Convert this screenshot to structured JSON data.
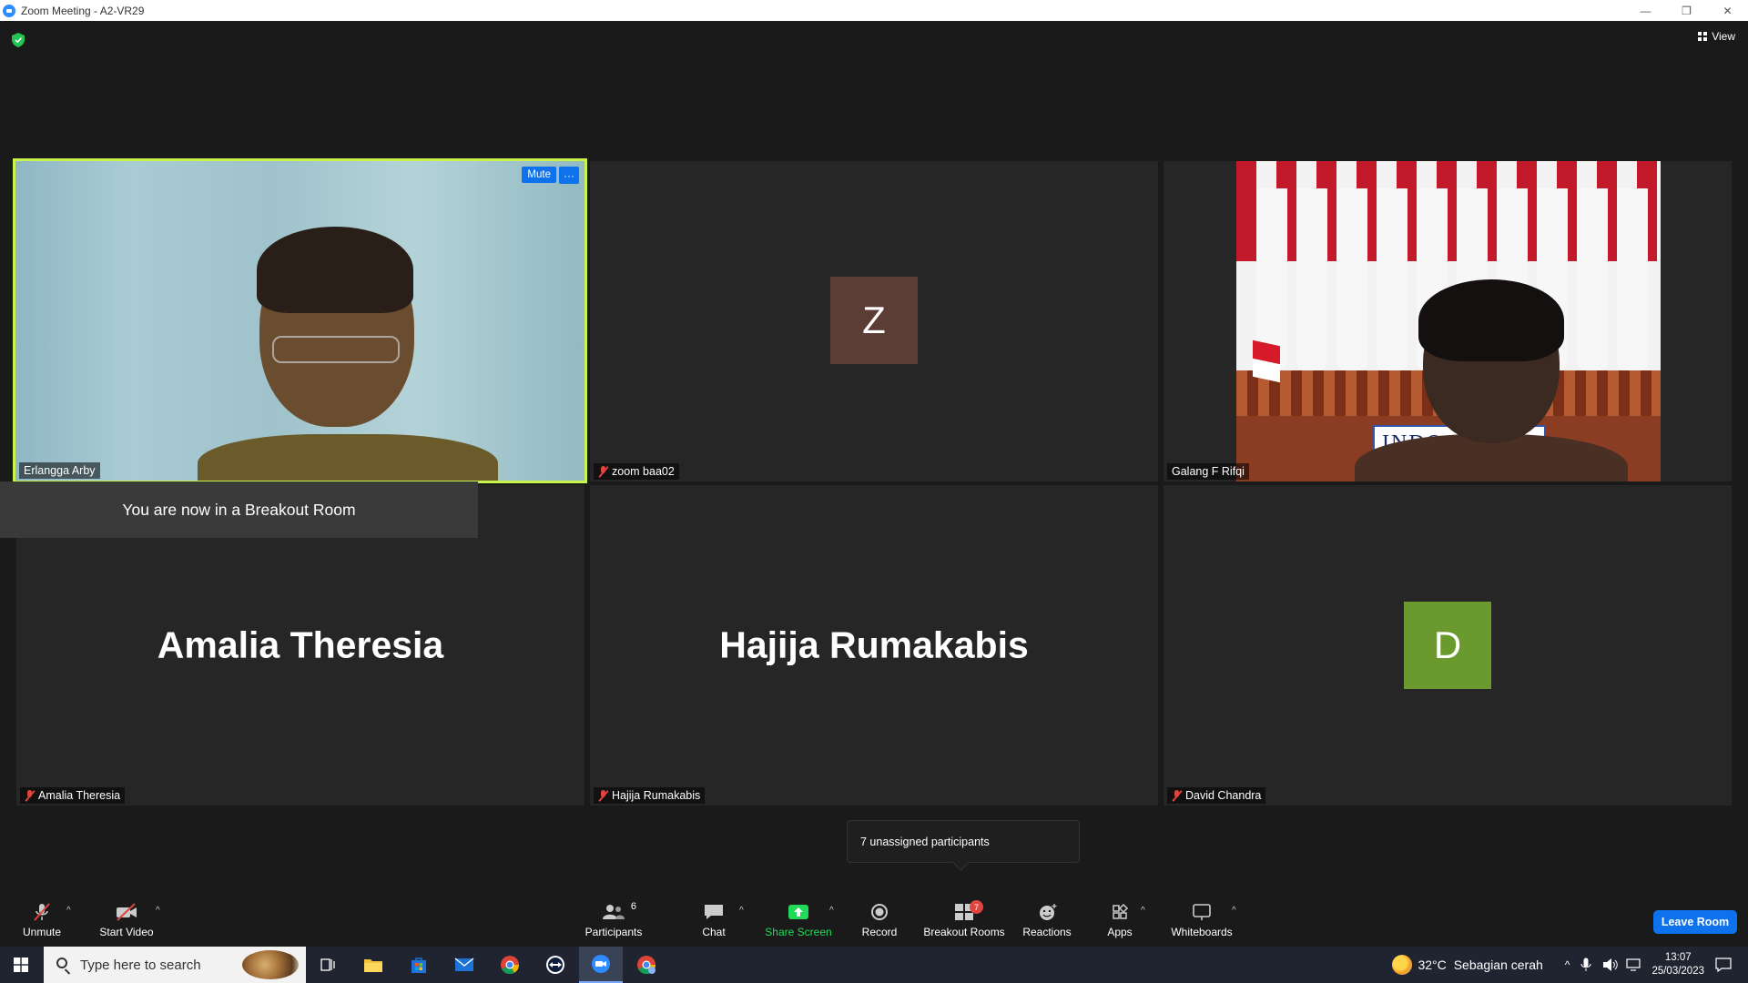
{
  "window": {
    "title": "Zoom Meeting - A2-VR29",
    "minimize": "—",
    "restore": "❐",
    "close": "✕"
  },
  "top": {
    "view_label": "View"
  },
  "tiles": [
    {
      "name": "Erlangga Arby",
      "mute_label": "Mute",
      "more_label": "···"
    },
    {
      "name": "zoom baa02",
      "avatar_letter": "Z",
      "avatar_color": "#5c3d36"
    },
    {
      "name": "Galang F Rifqi",
      "nameplate": "INDO"
    },
    {
      "name": "Amalia Theresia",
      "big_label": "Amalia Theresia"
    },
    {
      "name": "Hajija Rumakabis",
      "big_label": "Hajija Rumakabis"
    },
    {
      "name": "David Chandra",
      "avatar_letter": "D",
      "avatar_color": "#6a9a2e"
    }
  ],
  "notice": "You are now in a Breakout Room",
  "tooltip": "7 unassigned participants",
  "toolbar": {
    "unmute": "Unmute",
    "start_video": "Start Video",
    "participants": "Participants",
    "participants_count": "6",
    "chat": "Chat",
    "share_screen": "Share Screen",
    "record": "Record",
    "breakout_rooms": "Breakout Rooms",
    "breakout_badge": "7",
    "reactions": "Reactions",
    "apps": "Apps",
    "whiteboards": "Whiteboards",
    "leave": "Leave Room",
    "caret": "^"
  },
  "taskbar": {
    "search_placeholder": "Type here to search",
    "weather_temp": "32°C",
    "weather_text": "Sebagian cerah",
    "time": "13:07",
    "date": "25/03/2023"
  },
  "colors": {
    "accent": "#0e72ed",
    "active_border": "#c9f24a",
    "share_green": "#23d959",
    "muted_red": "#e0443e"
  }
}
